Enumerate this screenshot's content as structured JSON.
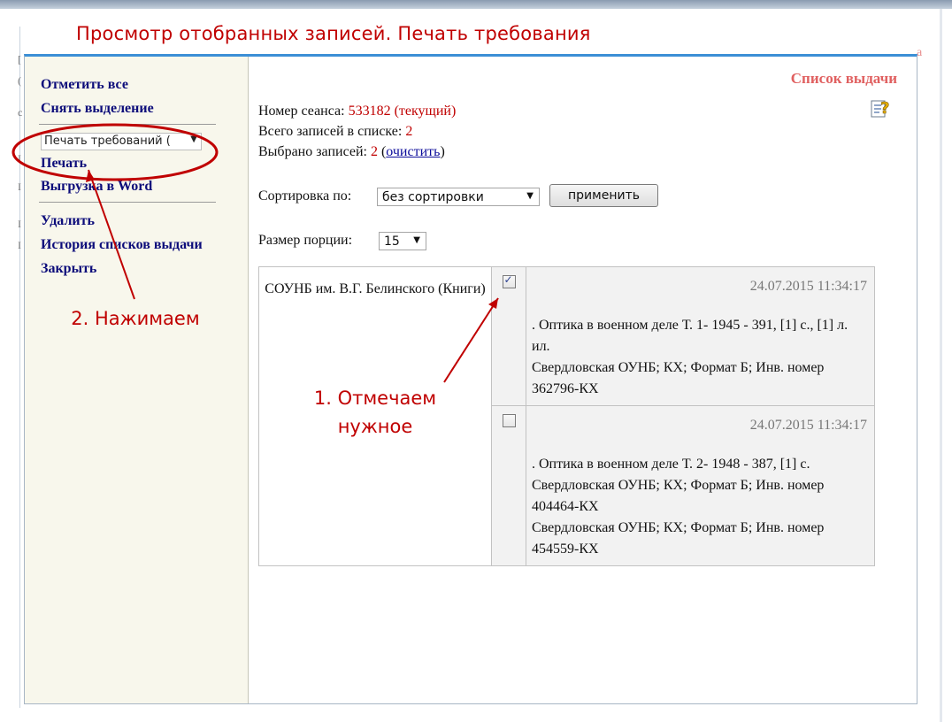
{
  "slide_title": "Просмотр отобранных записей. Печать требования",
  "sidebar": {
    "select_all": "Отметить все",
    "deselect": "Снять выделение",
    "print_select_value": "Печать требований (",
    "print": "Печать",
    "export_word": "Выгрузка в Word",
    "delete": "Удалить",
    "history": "История списков выдачи",
    "close": "Закрыть"
  },
  "main": {
    "list_title": "Список выдачи",
    "session_label": "Номер сеанса:",
    "session_value": "533182 (текущий)",
    "total_label": "Всего записей в списке:",
    "total_value": "2",
    "selected_label": "Выбрано записей:",
    "selected_value": "2",
    "clear_link": "очистить",
    "sort_label": "Сортировка по:",
    "sort_value": "без сортировки",
    "apply_button": "применить",
    "portion_label": "Размер порции:",
    "portion_value": "15"
  },
  "records": {
    "library": "СОУНБ им. В.Г. Белинского (Книги)",
    "items": [
      {
        "checked": true,
        "datetime": "24.07.2015   11:34:17",
        "title": ". Оптика в военном деле Т. 1- 1945 - 391, [1] с., [1] л. ил.",
        "holdings": [
          "Свердловская ОУНБ; КХ; Формат Б; Инв. номер 362796-КХ"
        ]
      },
      {
        "checked": false,
        "datetime": "24.07.2015   11:34:17",
        "title": ". Оптика в военном деле Т. 2- 1948 - 387, [1] с.",
        "holdings": [
          "Свердловская ОУНБ; КХ; Формат Б; Инв. номер 404464-КХ",
          "Свердловская ОУНБ; КХ; Формат Б; Инв. номер 454559-КХ"
        ]
      }
    ]
  },
  "annotations": {
    "step1": "1. Отмечаем нужное",
    "step2": "2. Нажимаем",
    "color": "#c00000"
  },
  "colors": {
    "accent_blue": "#3c8fd6",
    "sidebar_bg": "#f8f7ec",
    "link_navy": "#0c0c7a",
    "highlight_red": "#c00000"
  }
}
